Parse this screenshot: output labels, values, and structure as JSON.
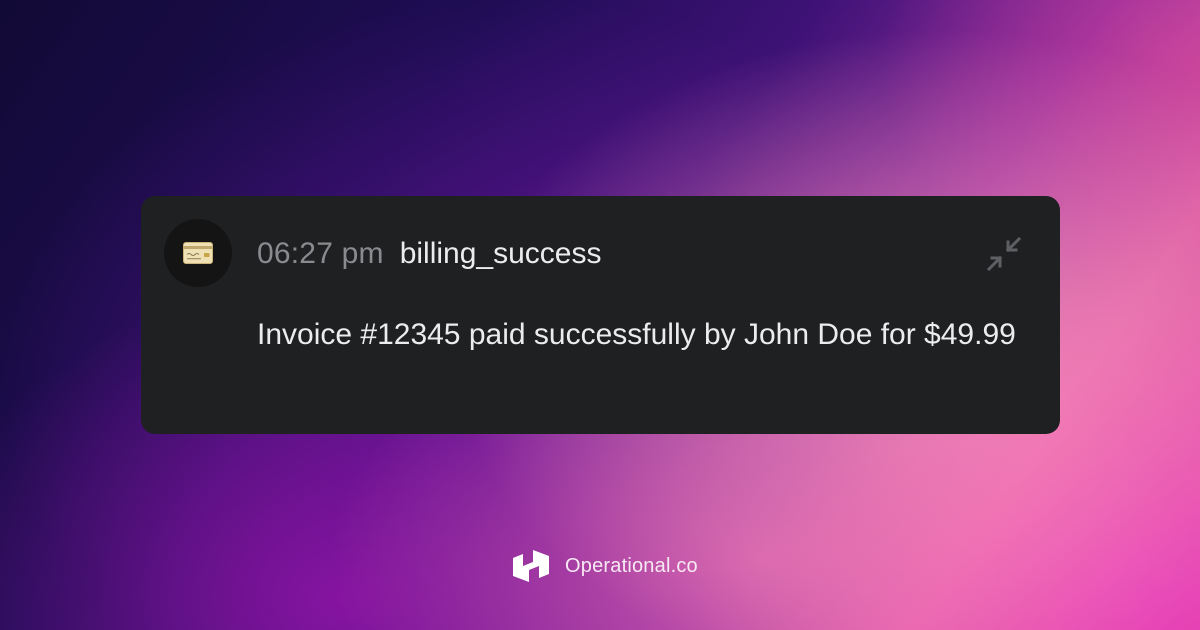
{
  "notification": {
    "time": "06:27 pm",
    "event": "billing_success",
    "message": "Invoice #12345 paid successfully by John Doe for $49.99",
    "icon": "credit-card-icon",
    "action_icon": "collapse-icon"
  },
  "brand": {
    "name": "Operational.co",
    "icon": "operational-logo-icon"
  },
  "colors": {
    "card_background": "#1f2022",
    "time_text": "#8a8b8f",
    "primary_text": "#ececee",
    "collapse_icon": "#5e5f63"
  }
}
